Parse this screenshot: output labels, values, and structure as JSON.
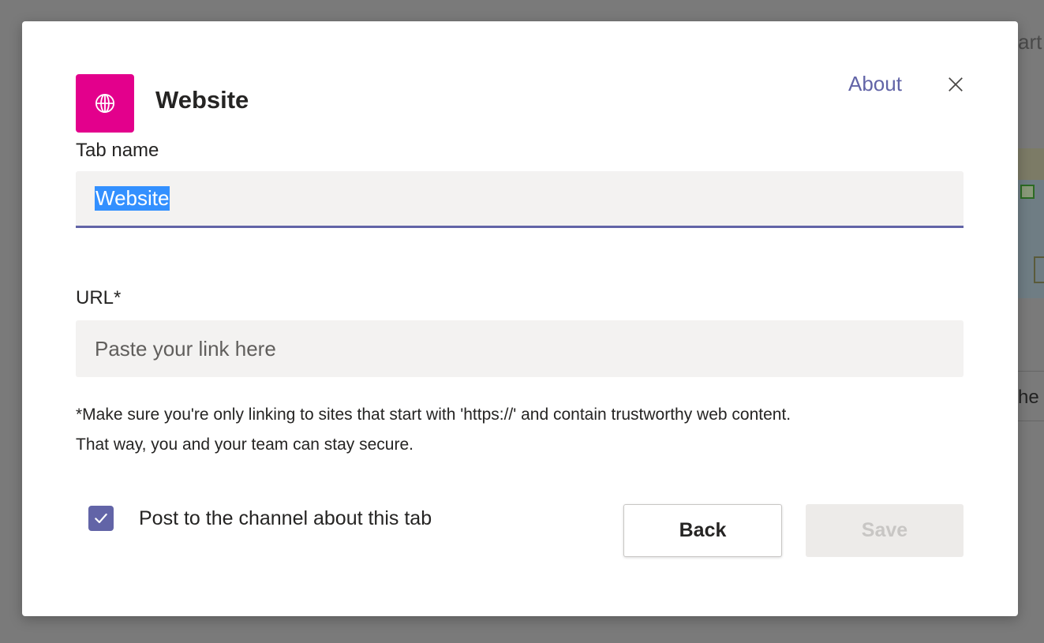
{
  "background_app": {
    "partial_text_top": "art",
    "partial_text_mid": "he"
  },
  "dialog": {
    "app_icon": {
      "name": "globe-icon",
      "bg_color": "#e3008c"
    },
    "title": "Website",
    "about_label": "About",
    "close_icon": "close-icon"
  },
  "form": {
    "tab_name": {
      "label": "Tab name",
      "value": "Website"
    },
    "url": {
      "label": "URL*",
      "placeholder": "Paste your link here",
      "value": ""
    },
    "helper_line1": "*Make sure you're only linking to sites that start with 'https://' and contain trustworthy web content.",
    "helper_line2": "That way, you and your team can stay secure.",
    "post_to_channel": {
      "label": "Post to the channel about this tab",
      "checked": true,
      "color": "#6264a7"
    }
  },
  "buttons": {
    "back_label": "Back",
    "save_label": "Save"
  },
  "colors": {
    "accent": "#6264a7",
    "app_tile": "#e3008c",
    "selection": "#3390ff"
  }
}
